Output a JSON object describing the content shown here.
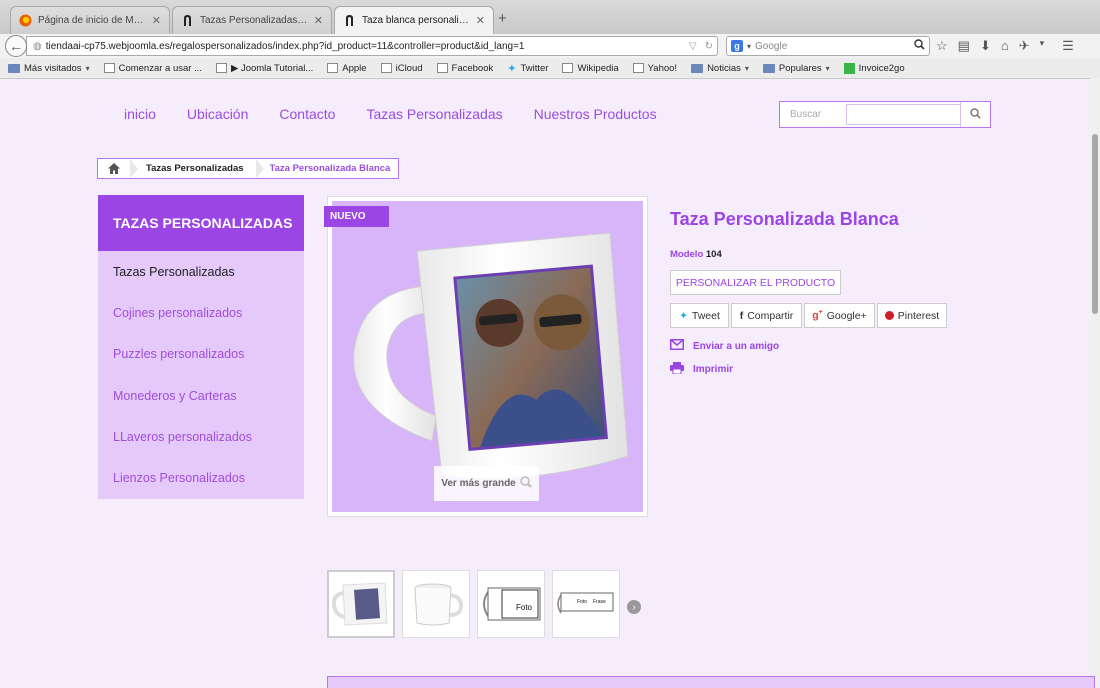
{
  "browser": {
    "tabs": [
      {
        "label": "Página de inicio de Mozill..."
      },
      {
        "label": "Tazas Personalizadas | Co..."
      },
      {
        "label": "Taza blanca personalizad..."
      }
    ],
    "new_tab": "+",
    "url": "tiendaai-cp75.webjoomla.es/regalospersonalizados/index.php?id_product=11&controller=product&id_lang=1",
    "search_placeholder": "Google",
    "bookmarks": [
      {
        "label": "Más visitados",
        "type": "folder-menu"
      },
      {
        "label": "Comenzar a usar ...",
        "type": "page"
      },
      {
        "label": "▶ Joomla Tutorial...",
        "type": "page"
      },
      {
        "label": "Apple",
        "type": "page"
      },
      {
        "label": "iCloud",
        "type": "page"
      },
      {
        "label": "Facebook",
        "type": "page"
      },
      {
        "label": "Twitter",
        "type": "twitter"
      },
      {
        "label": "Wikipedia",
        "type": "page"
      },
      {
        "label": "Yahoo!",
        "type": "page"
      },
      {
        "label": "Noticias",
        "type": "folder"
      },
      {
        "label": "Populares",
        "type": "folder"
      },
      {
        "label": "Invoice2go",
        "type": "invoice"
      }
    ]
  },
  "site": {
    "nav": [
      "inicio",
      "Ubicación",
      "Contacto",
      "Tazas Personalizadas",
      "Nuestros Productos"
    ],
    "search_label": "Buscar",
    "breadcrumb": {
      "category": "Tazas Personalizadas",
      "current": "Taza Personalizada Blanca"
    },
    "sidebar": {
      "title": "TAZAS PERSONALIZADAS",
      "items": [
        "Tazas Personalizadas",
        "Cojines personalizados",
        "Puzzles personalizados",
        "Monederos y Carteras",
        "LLaveros personalizados",
        "Lienzos Personalizados"
      ]
    },
    "product": {
      "badge": "NUEVO",
      "zoom_label": "Ver más grande",
      "title": "Taza Personalizada Blanca",
      "model_label": "Modelo",
      "model_value": "104",
      "personalize_label": "PERSONALIZAR EL PRODUCTO",
      "share": {
        "tweet": "Tweet",
        "facebook": "Compartir",
        "google": "Google+",
        "pinterest": "Pinterest"
      },
      "send_friend": "Enviar a un amigo",
      "print": "Imprimir",
      "thumb_labels": {
        "foto": "Foto",
        "foto_small": "Foto",
        "frase": "Frase"
      }
    }
  },
  "colors": {
    "accent": "#9b45e4",
    "sidebar_bg": "#e5c9fb",
    "page_bg": "#f5ecfc",
    "image_bg": "#d8b4f8"
  }
}
